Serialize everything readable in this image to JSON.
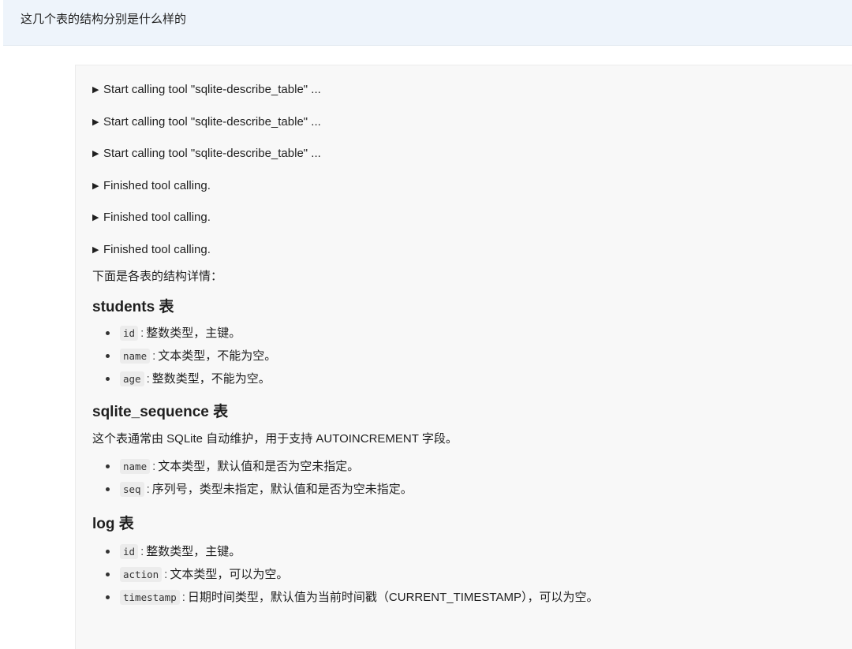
{
  "user_message": "这几个表的结构分别是什么样的",
  "tool_calls": [
    "Start calling tool \"sqlite-describe_table\" ...",
    "Start calling tool \"sqlite-describe_table\" ...",
    "Start calling tool \"sqlite-describe_table\" ...",
    "Finished tool calling.",
    "Finished tool calling.",
    "Finished tool calling."
  ],
  "intro": "下面是各表的结构详情：",
  "sections": [
    {
      "title": "students 表",
      "description": "",
      "fields": [
        {
          "name": "id",
          "desc": "整数类型，主键。"
        },
        {
          "name": "name",
          "desc": "文本类型，不能为空。"
        },
        {
          "name": "age",
          "desc": "整数类型，不能为空。"
        }
      ]
    },
    {
      "title": "sqlite_sequence 表",
      "description": "这个表通常由 SQLite 自动维护，用于支持 AUTOINCREMENT 字段。",
      "fields": [
        {
          "name": "name",
          "desc": "文本类型，默认值和是否为空未指定。"
        },
        {
          "name": "seq",
          "desc": "序列号，类型未指定，默认值和是否为空未指定。"
        }
      ]
    },
    {
      "title": "log 表",
      "description": "",
      "fields": [
        {
          "name": "id",
          "desc": "整数类型，主键。"
        },
        {
          "name": "action",
          "desc": "文本类型，可以为空。"
        },
        {
          "name": "timestamp",
          "desc": "日期时间类型，默认值为当前时间戳（CURRENT_TIMESTAMP），可以为空。"
        }
      ]
    }
  ],
  "field_separator": ":"
}
